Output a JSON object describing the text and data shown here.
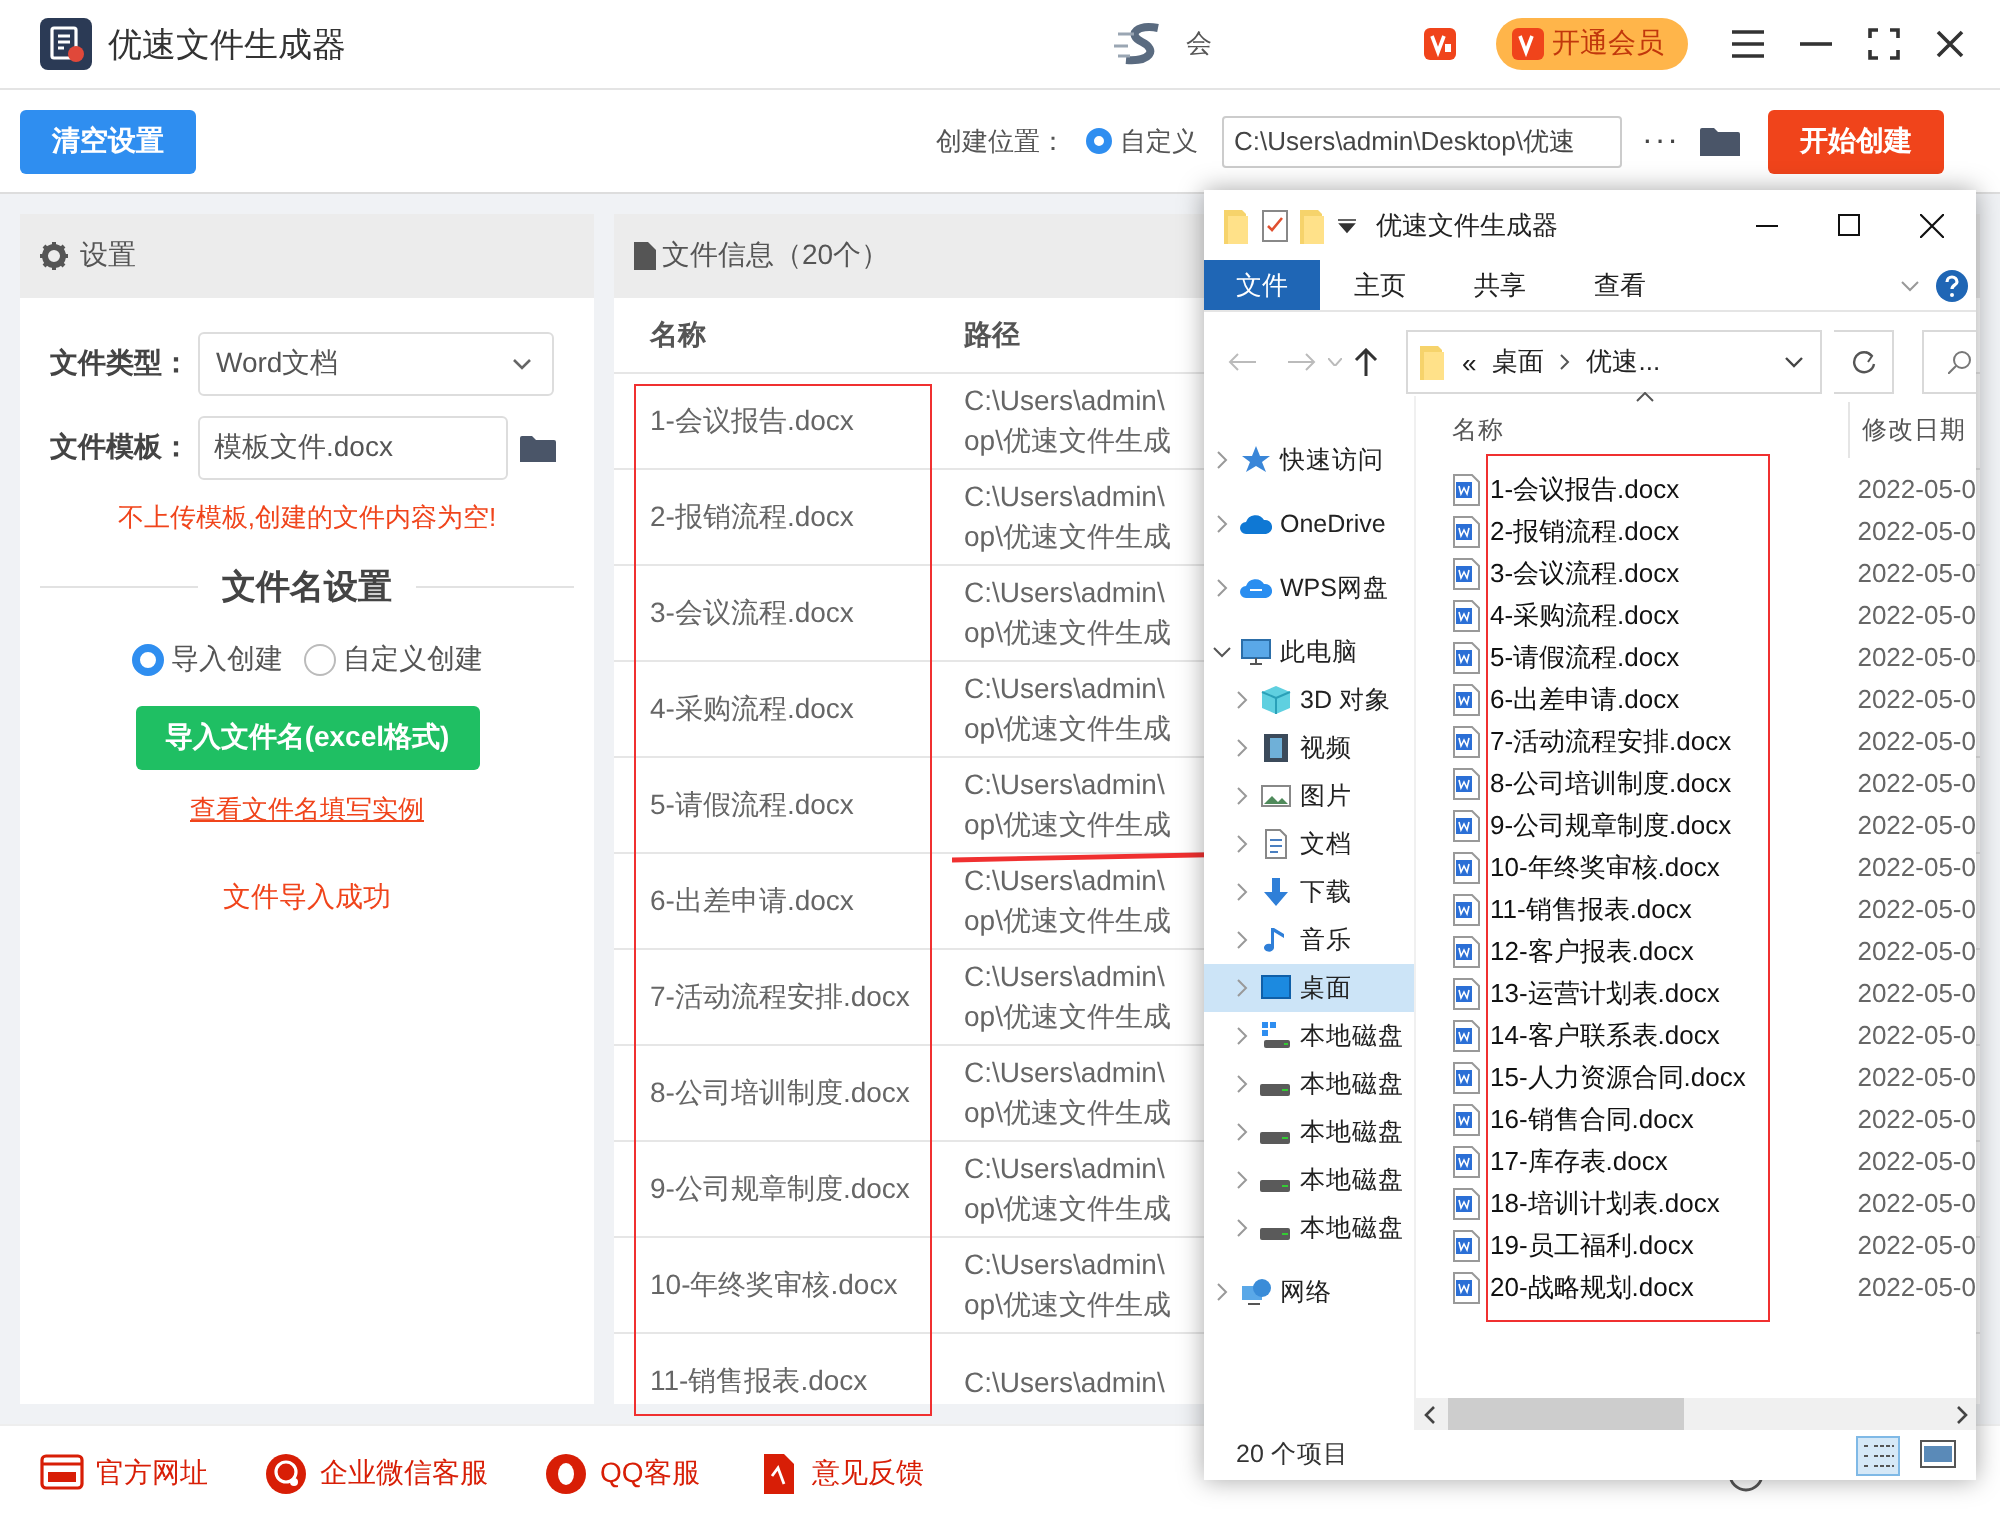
{
  "app": {
    "title": "优速文件生成器",
    "member_text": "会",
    "vip_button": "开通会员"
  },
  "toolbar": {
    "clear_button": "清空设置",
    "location_label": "创建位置：",
    "location_option": {
      "label": "自定义",
      "selected": true
    },
    "path_value": "C:\\Users\\admin\\Desktop\\优速",
    "more": "···",
    "start_button": "开始创建"
  },
  "settings": {
    "title": "设置",
    "file_type": {
      "label": "文件类型：",
      "value": "Word文档"
    },
    "template": {
      "label": "文件模板：",
      "value": "模板文件.docx"
    },
    "warning": "不上传模板,创建的文件内容为空!",
    "section_title": "文件名设置",
    "modes": [
      {
        "label": "导入创建",
        "selected": true
      },
      {
        "label": "自定义创建",
        "selected": false
      }
    ],
    "import_button": "导入文件名(excel格式)",
    "example_link": "查看文件名填写实例",
    "status": "文件导入成功"
  },
  "file_info": {
    "title": "文件信息（20个）",
    "columns": [
      "名称",
      "路径"
    ],
    "rows": [
      {
        "name": "1-会议报告.docx",
        "path": [
          "C:\\Users\\admin\\",
          "op\\优速文件生成"
        ]
      },
      {
        "name": "2-报销流程.docx",
        "path": [
          "C:\\Users\\admin\\",
          "op\\优速文件生成"
        ]
      },
      {
        "name": "3-会议流程.docx",
        "path": [
          "C:\\Users\\admin\\",
          "op\\优速文件生成"
        ]
      },
      {
        "name": "4-采购流程.docx",
        "path": [
          "C:\\Users\\admin\\",
          "op\\优速文件生成"
        ]
      },
      {
        "name": "5-请假流程.docx",
        "path": [
          "C:\\Users\\admin\\",
          "op\\优速文件生成"
        ]
      },
      {
        "name": "6-出差申请.docx",
        "path": [
          "C:\\Users\\admin\\",
          "op\\优速文件生成"
        ]
      },
      {
        "name": "7-活动流程安排.docx",
        "path": [
          "C:\\Users\\admin\\",
          "op\\优速文件生成"
        ]
      },
      {
        "name": "8-公司培训制度.docx",
        "path": [
          "C:\\Users\\admin\\",
          "op\\优速文件生成"
        ]
      },
      {
        "name": "9-公司规章制度.docx",
        "path": [
          "C:\\Users\\admin\\",
          "op\\优速文件生成"
        ]
      },
      {
        "name": "10-年终奖审核.docx",
        "path": [
          "C:\\Users\\admin\\",
          "op\\优速文件生成"
        ]
      },
      {
        "name": "11-销售报表.docx",
        "path": [
          "C:\\Users\\admin\\"
        ]
      }
    ]
  },
  "footer": {
    "links": [
      {
        "kind": "web",
        "label": "官方网址"
      },
      {
        "kind": "wechat",
        "label": "企业微信客服"
      },
      {
        "kind": "qq",
        "label": "QQ客服"
      },
      {
        "kind": "feedback",
        "label": "意见反馈"
      }
    ]
  },
  "explorer": {
    "title": "优速文件生成器",
    "ribbon_tabs": [
      {
        "label": "文件",
        "selected": true
      },
      {
        "label": "主页",
        "selected": false
      },
      {
        "label": "共享",
        "selected": false
      },
      {
        "label": "查看",
        "selected": false
      }
    ],
    "address": {
      "prefix": "«",
      "segments": [
        "桌面",
        "优速..."
      ]
    },
    "nav": [
      {
        "kind": "star",
        "label": "快速访问",
        "expanded": false
      },
      {
        "kind": "cloud",
        "label": "OneDrive",
        "expanded": false
      },
      {
        "kind": "wps",
        "label": "WPS网盘",
        "expanded": false
      },
      {
        "kind": "pc",
        "label": "此电脑",
        "expanded": true,
        "children": [
          {
            "kind": "cube",
            "label": "3D 对象",
            "selected": false
          },
          {
            "kind": "video",
            "label": "视频",
            "selected": false
          },
          {
            "kind": "image",
            "label": "图片",
            "selected": false
          },
          {
            "kind": "doc",
            "label": "文档",
            "selected": false
          },
          {
            "kind": "download",
            "label": "下载",
            "selected": false
          },
          {
            "kind": "music",
            "label": "音乐",
            "selected": false
          },
          {
            "kind": "desktop",
            "label": "桌面",
            "selected": true
          },
          {
            "kind": "sysdisk",
            "label": "本地磁盘",
            "selected": false
          },
          {
            "kind": "disk",
            "label": "本地磁盘",
            "selected": false
          },
          {
            "kind": "disk",
            "label": "本地磁盘",
            "selected": false
          },
          {
            "kind": "disk",
            "label": "本地磁盘",
            "selected": false
          },
          {
            "kind": "disk",
            "label": "本地磁盘",
            "selected": false
          }
        ]
      },
      {
        "kind": "network",
        "label": "网络",
        "expanded": false
      }
    ],
    "columns": [
      "名称",
      "修改日期"
    ],
    "files": [
      {
        "name": "1-会议报告.docx",
        "date": "2022-05-0"
      },
      {
        "name": "2-报销流程.docx",
        "date": "2022-05-0"
      },
      {
        "name": "3-会议流程.docx",
        "date": "2022-05-0"
      },
      {
        "name": "4-采购流程.docx",
        "date": "2022-05-0"
      },
      {
        "name": "5-请假流程.docx",
        "date": "2022-05-0"
      },
      {
        "name": "6-出差申请.docx",
        "date": "2022-05-0"
      },
      {
        "name": "7-活动流程安排.docx",
        "date": "2022-05-0"
      },
      {
        "name": "8-公司培训制度.docx",
        "date": "2022-05-0"
      },
      {
        "name": "9-公司规章制度.docx",
        "date": "2022-05-0"
      },
      {
        "name": "10-年终奖审核.docx",
        "date": "2022-05-0"
      },
      {
        "name": "11-销售报表.docx",
        "date": "2022-05-0"
      },
      {
        "name": "12-客户报表.docx",
        "date": "2022-05-0"
      },
      {
        "name": "13-运营计划表.docx",
        "date": "2022-05-0"
      },
      {
        "name": "14-客户联系表.docx",
        "date": "2022-05-0"
      },
      {
        "name": "15-人力资源合同.docx",
        "date": "2022-05-0"
      },
      {
        "name": "16-销售合同.docx",
        "date": "2022-05-0"
      },
      {
        "name": "17-库存表.docx",
        "date": "2022-05-0"
      },
      {
        "name": "18-培训计划表.docx",
        "date": "2022-05-0"
      },
      {
        "name": "19-员工福利.docx",
        "date": "2022-05-0"
      },
      {
        "name": "20-战略规划.docx",
        "date": "2022-05-0"
      }
    ],
    "status": "20 个项目"
  }
}
